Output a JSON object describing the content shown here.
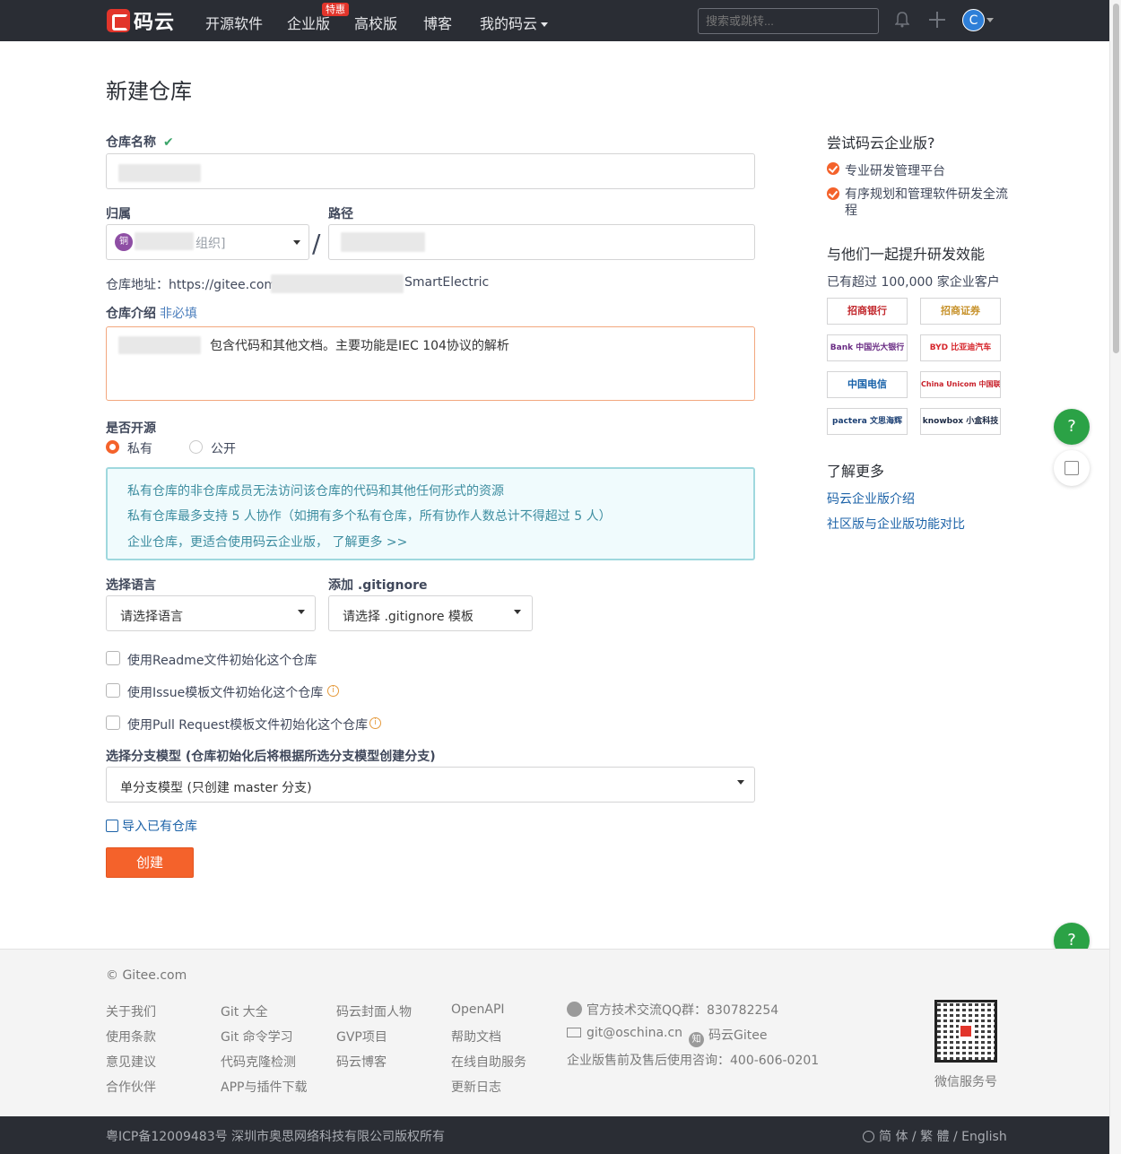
{
  "nav": {
    "logo_text": "码云",
    "items": [
      "开源软件",
      "企业版",
      "高校版",
      "博客",
      "我的码云"
    ],
    "hot_badge": "特惠",
    "search_placeholder": "搜索或跳转...",
    "avatar_initial": "C"
  },
  "form": {
    "title": "新建仓库",
    "name_label": "仓库名称",
    "name_check": "✔",
    "owner_label": "归属",
    "owner_badge": "铜",
    "owner_suffix": "组织]",
    "path_label": "路径",
    "path_separator": "/",
    "address_prefix": "仓库地址：https://gitee.com/",
    "address_suffix": "SmartElectric",
    "desc_label": "仓库介绍",
    "desc_optional": "非必填",
    "desc_value": "包含代码和其他文档。主要功能是IEC 104协议的解析",
    "open_source_label": "是否开源",
    "visibility_options": [
      "私有",
      "公开"
    ],
    "visibility_selected": "私有",
    "notice_lines": [
      "私有仓库的非仓库成员无法访问该仓库的代码和其他任何形式的资源",
      "私有仓库最多支持 5 人协作（如拥有多个私有仓库，所有协作人数总计不得超过 5 人）",
      "企业仓库，更适合使用码云企业版，  了解更多 >>"
    ],
    "language_label": "选择语言",
    "language_value": "请选择语言",
    "gitignore_label": "添加 .gitignore",
    "gitignore_value": "请选择 .gitignore 模板",
    "init_options": [
      "使用Readme文件初始化这个仓库",
      "使用Issue模板文件初始化这个仓库",
      "使用Pull Request模板文件初始化这个仓库"
    ],
    "branch_label": "选择分支模型 (仓库初始化后将根据所选分支模型创建分支)",
    "branch_value": "单分支模型 (只创建 master 分支)",
    "import_link": "导入已有仓库",
    "create_button": "创建"
  },
  "sidebar": {
    "try_heading": "尝试码云企业版?",
    "benefits": [
      "专业研发管理平台",
      "有序规划和管理软件研发全流程"
    ],
    "together_heading": "与他们一起提升研发效能",
    "customers_text": "已有超过 100,000 家企业客户",
    "clients": [
      "招商银行",
      "招商证券",
      "Bank 中国光大银行",
      "BYD 比亚迪汽车",
      "中国电信",
      "China Unicom 中国联通",
      "pactera 文思海辉",
      "knowbox 小盒科技"
    ],
    "learn_heading": "了解更多",
    "links": [
      "码云企业版介绍",
      "社区版与企业版功能对比"
    ]
  },
  "float": {
    "help": "?"
  },
  "footer": {
    "copyright": "© Gitee.com",
    "columns": [
      [
        "关于我们",
        "使用条款",
        "意见建议",
        "合作伙伴"
      ],
      [
        "Git 大全",
        "Git 命令学习",
        "代码克隆检测",
        "APP与插件下载"
      ],
      [
        "码云封面人物",
        "GVP项目",
        "码云博客"
      ],
      [
        "OpenAPI",
        "帮助文档",
        "在线自助服务",
        "更新日志"
      ]
    ],
    "qq_group": "官方技术交流QQ群：830782254",
    "email": "git@oschina.cn",
    "zhihu_icon": "知",
    "zhihu": "码云Gitee",
    "phone": "企业版售前及售后使用咨询：400-606-0201",
    "qr_label": "微信服务号",
    "icp": "粤ICP备12009483号 深圳市奥思网络科技有限公司版权所有",
    "languages": "简 体 / 繁 體 / English"
  }
}
